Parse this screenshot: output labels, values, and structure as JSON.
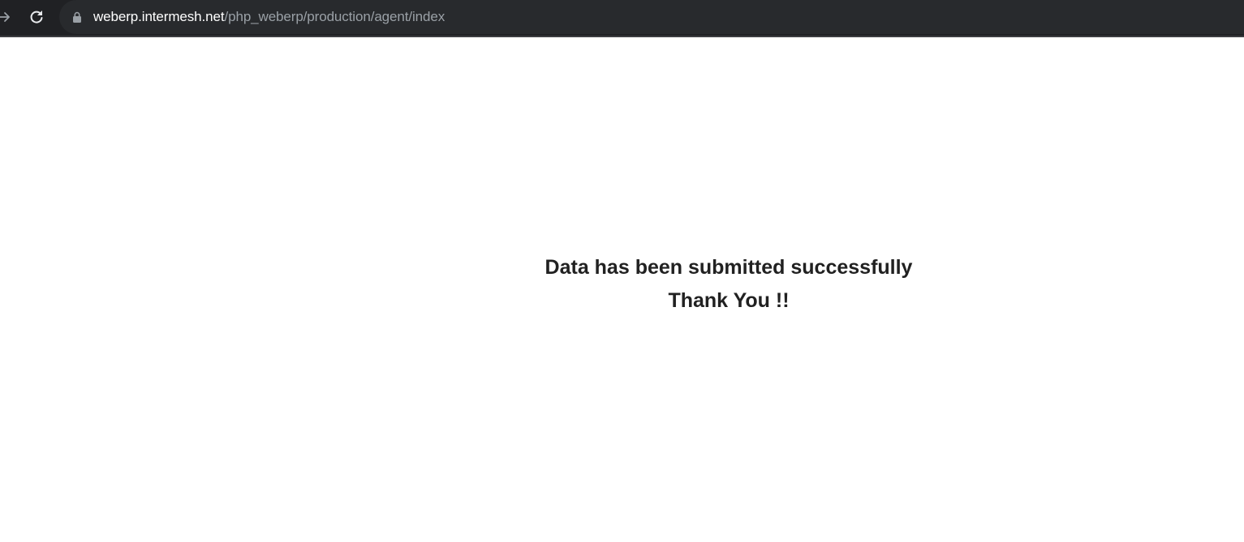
{
  "browser": {
    "url_host": "weberp.intermesh.net",
    "url_path": "/php_weberp/production/agent/index",
    "icons": {
      "forward": "arrow-right-icon",
      "reload": "reload-icon",
      "lock": "lock-icon"
    }
  },
  "page": {
    "message": "Data has been submitted successfully",
    "thanks": "Thank You !!"
  }
}
